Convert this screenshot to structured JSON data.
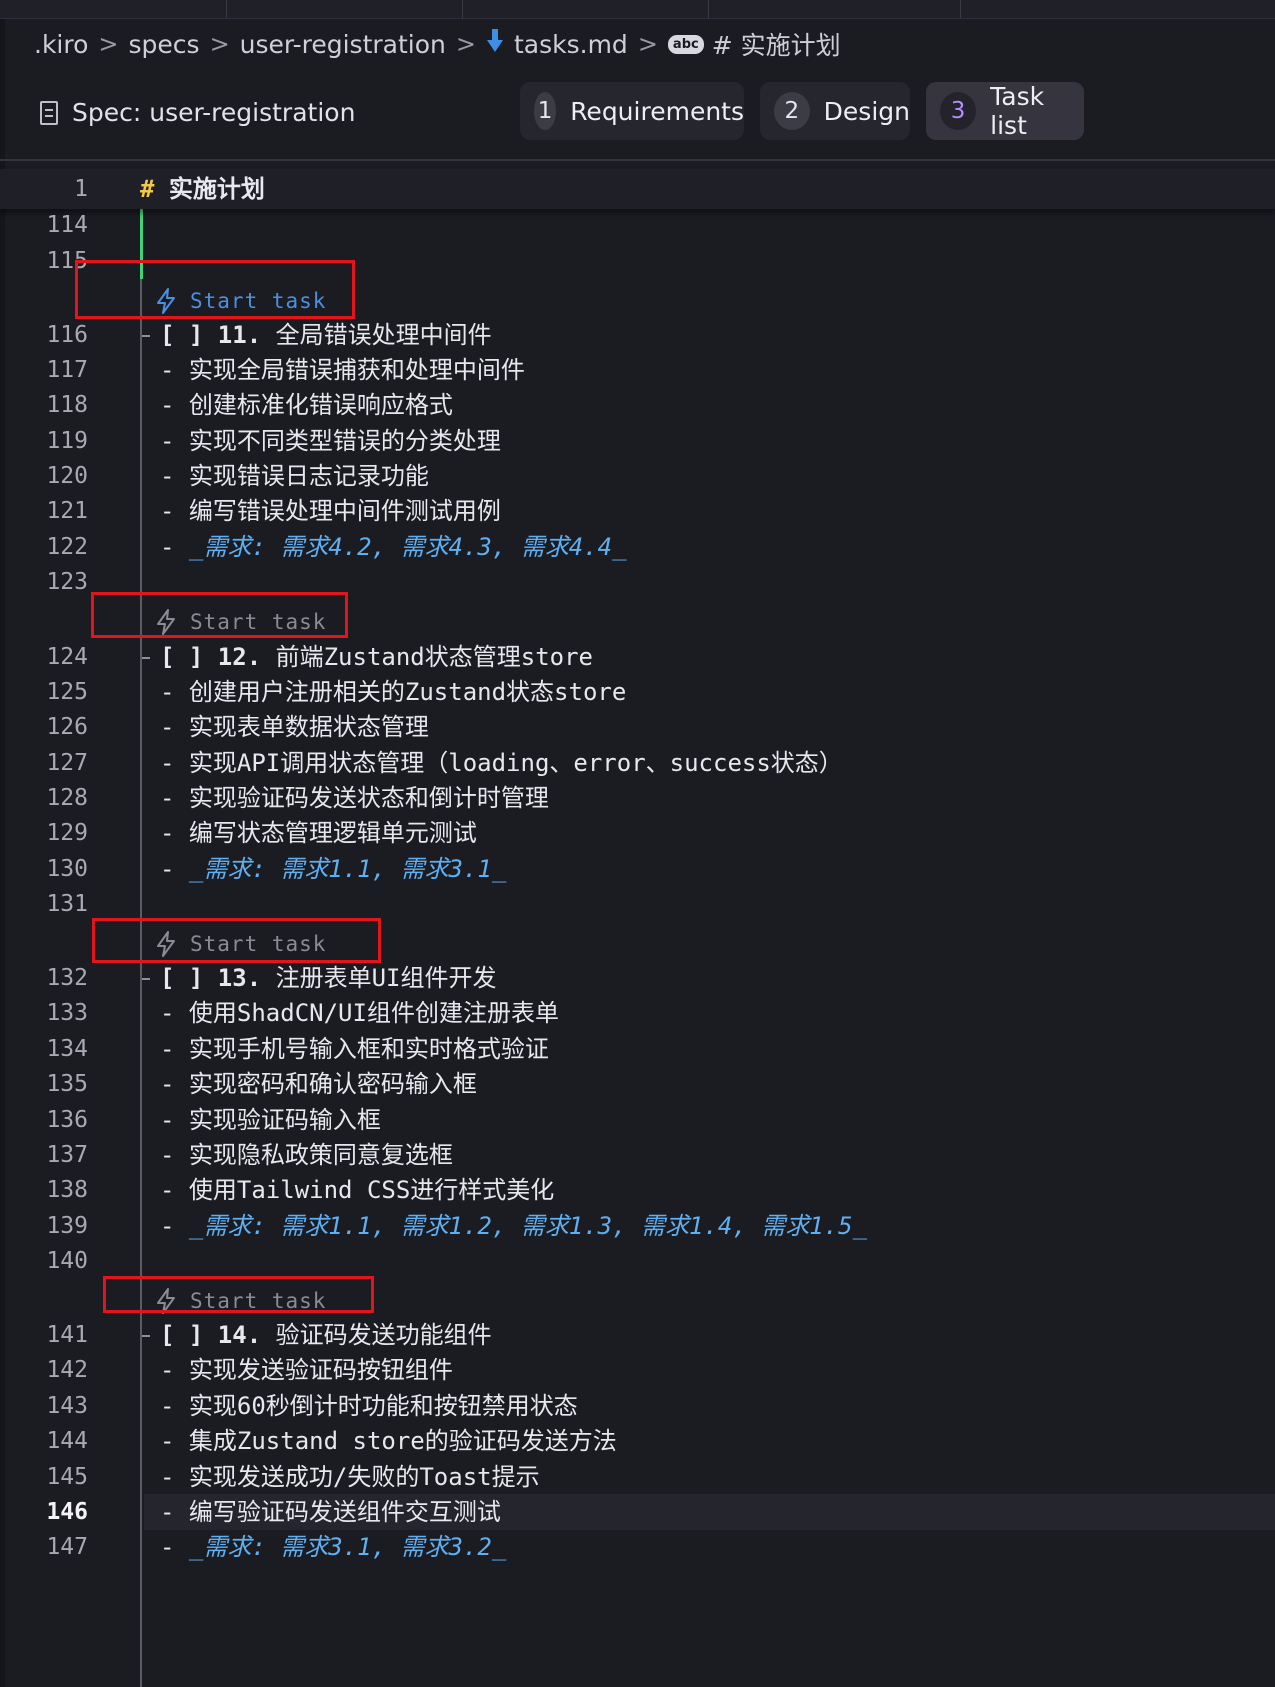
{
  "breadcrumb": {
    "items": [
      ".kiro",
      "specs",
      "user-registration",
      "tasks.md",
      "# 实施计划"
    ],
    "separator": ">",
    "file_icon": "markdown-file-icon",
    "symbol_icon": "abc-symbol-icon",
    "symbol_icon_text": "abc"
  },
  "spec_header": {
    "title": "Spec: user-registration",
    "icon": "document-icon",
    "steps": [
      {
        "number": "1",
        "label": "Requirements",
        "active": false
      },
      {
        "number": "2",
        "label": "Design",
        "active": false
      },
      {
        "number": "3",
        "label": "Task list",
        "active": true
      }
    ]
  },
  "sticky": {
    "line_number": "1",
    "hash": "#",
    "text": "实施计划"
  },
  "codelens_label": "Start task",
  "lines": [
    {
      "n": "114"
    },
    {
      "n": "115"
    },
    {
      "n": "116",
      "dash": "- ",
      "box": "[ ]",
      "num": " 11.",
      "text": " 全局错误处理中间件"
    },
    {
      "n": "117",
      "dash": "- ",
      "text": "实现全局错误捕获和处理中间件"
    },
    {
      "n": "118",
      "dash": "- ",
      "text": "创建标准化错误响应格式"
    },
    {
      "n": "119",
      "dash": "- ",
      "text": "实现不同类型错误的分类处理"
    },
    {
      "n": "120",
      "dash": "- ",
      "text": "实现错误日志记录功能"
    },
    {
      "n": "121",
      "dash": "- ",
      "text": "编写错误处理中间件测试用例"
    },
    {
      "n": "122",
      "dash": "- ",
      "req": "_需求: 需求4.2, 需求4.3, 需求4.4_"
    },
    {
      "n": "123"
    },
    {
      "n": "124",
      "dash": "- ",
      "box": "[ ]",
      "num": " 12.",
      "text": " 前端Zustand状态管理store"
    },
    {
      "n": "125",
      "dash": "- ",
      "text": "创建用户注册相关的Zustand状态store"
    },
    {
      "n": "126",
      "dash": "- ",
      "text": "实现表单数据状态管理"
    },
    {
      "n": "127",
      "dash": "- ",
      "text": "实现API调用状态管理（loading、error、success状态）"
    },
    {
      "n": "128",
      "dash": "- ",
      "text": "实现验证码发送状态和倒计时管理"
    },
    {
      "n": "129",
      "dash": "- ",
      "text": "编写状态管理逻辑单元测试"
    },
    {
      "n": "130",
      "dash": "- ",
      "req": "_需求: 需求1.1, 需求3.1_"
    },
    {
      "n": "131"
    },
    {
      "n": "132",
      "dash": "- ",
      "box": "[ ]",
      "num": " 13.",
      "text": " 注册表单UI组件开发"
    },
    {
      "n": "133",
      "dash": "- ",
      "text": "使用ShadCN/UI组件创建注册表单"
    },
    {
      "n": "134",
      "dash": "- ",
      "text": "实现手机号输入框和实时格式验证"
    },
    {
      "n": "135",
      "dash": "- ",
      "text": "实现密码和确认密码输入框"
    },
    {
      "n": "136",
      "dash": "- ",
      "text": "实现验证码输入框"
    },
    {
      "n": "137",
      "dash": "- ",
      "text": "实现隐私政策同意复选框"
    },
    {
      "n": "138",
      "dash": "- ",
      "text": "使用Tailwind CSS进行样式美化"
    },
    {
      "n": "139",
      "dash": "- ",
      "req": "_需求: 需求1.1, 需求1.2, 需求1.3, 需求1.4, 需求1.5_"
    },
    {
      "n": "140"
    },
    {
      "n": "141",
      "dash": "- ",
      "box": "[ ]",
      "num": " 14.",
      "text": " 验证码发送功能组件"
    },
    {
      "n": "142",
      "dash": "- ",
      "text": "实现发送验证码按钮组件"
    },
    {
      "n": "143",
      "dash": "- ",
      "text": "实现60秒倒计时功能和按钮禁用状态"
    },
    {
      "n": "144",
      "dash": "- ",
      "text": "集成Zustand store的验证码发送方法"
    },
    {
      "n": "145",
      "dash": "- ",
      "text": "实现发送成功/失败的Toast提示"
    },
    {
      "n": "146",
      "dash": "- ",
      "text": "编写验证码发送组件交互测试",
      "current": true
    },
    {
      "n": "147",
      "dash": "- ",
      "req": "_需求: 需求3.1, 需求3.2_"
    }
  ],
  "colors": {
    "accent_purple": "#b48cff",
    "codelens_blue": "#4b90e0",
    "requirement_link": "#5fb0f2",
    "heading_hash": "#f0c94b",
    "highlight_box": "#e3141b",
    "git_added": "#3fd37a"
  }
}
